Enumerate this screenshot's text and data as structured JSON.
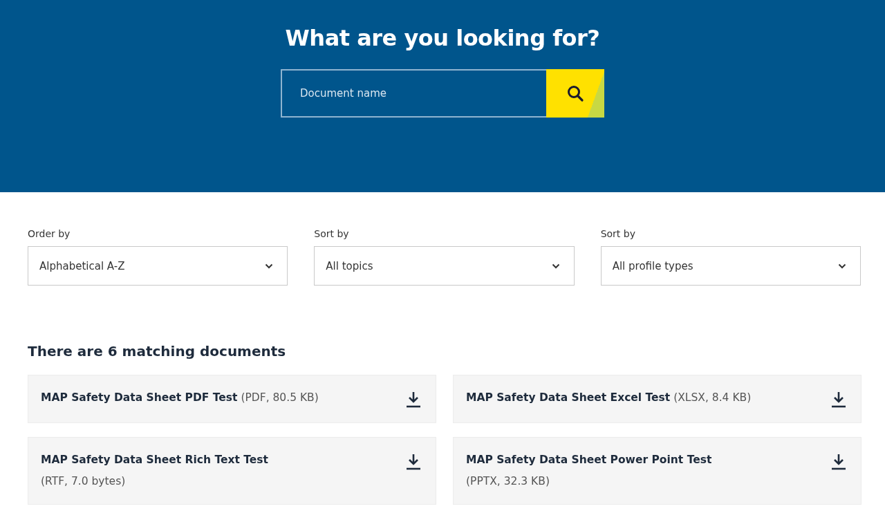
{
  "hero": {
    "title": "What are you looking for?",
    "search": {
      "placeholder": "Document name"
    }
  },
  "filters": [
    {
      "label": "Order by",
      "value": "Alphabetical A-Z"
    },
    {
      "label": "Sort by",
      "value": "All topics"
    },
    {
      "label": "Sort by",
      "value": "All profile types"
    }
  ],
  "results_heading": "There are 6 matching documents",
  "documents": [
    {
      "title": "MAP Safety Data Sheet PDF Test",
      "meta": "(PDF, 80.5 KB)",
      "meta_on_new_line": false
    },
    {
      "title": "MAP Safety Data Sheet Excel Test",
      "meta": "(XLSX, 8.4 KB)",
      "meta_on_new_line": false
    },
    {
      "title": "MAP Safety Data Sheet Rich Text Test",
      "meta": "(RTF, 7.0 bytes)",
      "meta_on_new_line": true
    },
    {
      "title": "MAP Safety Data Sheet Power Point Test",
      "meta": "(PPTX, 32.3 KB)",
      "meta_on_new_line": true
    }
  ]
}
